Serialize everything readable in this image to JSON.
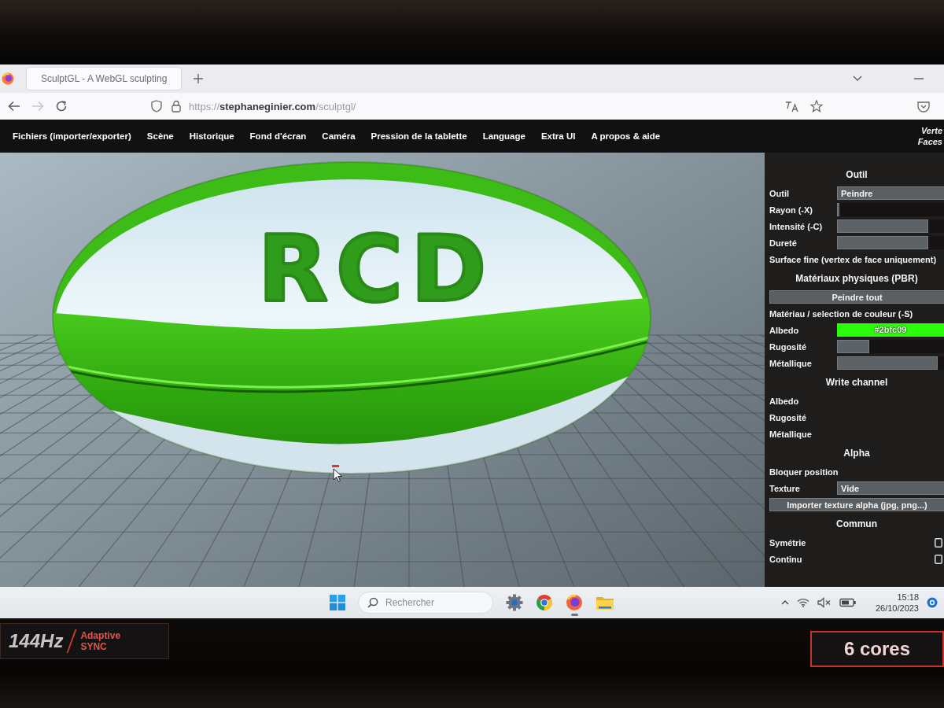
{
  "browser": {
    "tab": {
      "title": "SculptGL - A WebGL sculpting",
      "selected": true
    },
    "nav_buttons": [
      {
        "kind": "back",
        "disabled": false
      },
      {
        "kind": "forward",
        "disabled": true
      },
      {
        "kind": "reload",
        "disabled": false
      }
    ],
    "url": "https://**stephaneginier.com**/sculptgl/"
  },
  "menu": {
    "items": [
      "Fichiers (importer/exporter)",
      "Scène",
      "Historique",
      "Fond d'écran",
      "Caméra",
      "Pression de la tablette",
      "Language",
      "Extra UI",
      "A propos & aide"
    ],
    "stats": [
      "Verte",
      "Faces"
    ]
  },
  "viewport": {
    "model_lettering": "RCD"
  },
  "panel": {
    "sections": [
      {
        "title": "Outil",
        "rows": [
          {
            "kind": "select",
            "label": "Outil",
            "value": "Peindre"
          },
          {
            "kind": "slider",
            "label": "Rayon (-X)",
            "level": 0.02
          },
          {
            "kind": "slider",
            "label": "Intensité (-C)",
            "level": 0.85
          },
          {
            "kind": "slider",
            "label": "Dureté",
            "level": 0.85
          },
          {
            "kind": "label",
            "label": "Surface fine (vertex de face uniquement)"
          }
        ]
      },
      {
        "title": "Matériaux physiques (PBR)",
        "rows": [
          {
            "kind": "button",
            "label": "Peindre tout"
          },
          {
            "kind": "label",
            "label": "Matériau / selection de couleur (-S)"
          },
          {
            "kind": "color",
            "label": "Albedo",
            "value": "#2bfc09",
            "color": "#2bfc09"
          },
          {
            "kind": "slider",
            "label": "Rugosité",
            "level": 0.3
          },
          {
            "kind": "slider",
            "label": "Métallique",
            "level": 0.94
          }
        ]
      },
      {
        "title": "Write channel",
        "rows": [
          {
            "kind": "label",
            "label": "Albedo"
          },
          {
            "kind": "label",
            "label": "Rugosité"
          },
          {
            "kind": "label",
            "label": "Métallique"
          }
        ]
      },
      {
        "title": "Alpha",
        "rows": [
          {
            "kind": "label",
            "label": "Bloquer position"
          },
          {
            "kind": "select",
            "label": "Texture",
            "value": "Vide"
          },
          {
            "kind": "button",
            "label": "Importer texture alpha (jpg, png...)"
          }
        ]
      },
      {
        "title": "Commun",
        "rows": [
          {
            "kind": "checkbox",
            "label": "Symétrie",
            "checked": false
          },
          {
            "kind": "checkbox",
            "label": "Continu",
            "checked": false
          }
        ]
      }
    ]
  },
  "taskbar": {
    "search": {
      "placeholder": "Rechercher"
    },
    "apps": [
      {
        "kind": "gear",
        "running": false
      },
      {
        "kind": "chrome",
        "running": false
      },
      {
        "kind": "firefox",
        "running": true
      },
      {
        "kind": "folder",
        "running": false
      }
    ],
    "time": "15:18",
    "date": "26/10/2023"
  },
  "stickers": [
    {
      "kind": "refresh",
      "texts": [
        "144Hz",
        "Adaptive SYNC"
      ]
    },
    {
      "kind": "cores",
      "texts": [
        "6 cores"
      ]
    }
  ]
}
